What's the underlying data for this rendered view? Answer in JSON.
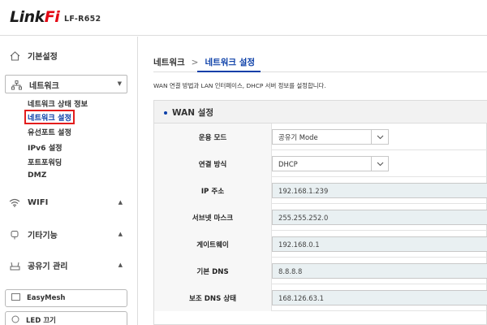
{
  "header": {
    "logo_main": "Link",
    "logo_accent": "Fi",
    "model": "LF-R652"
  },
  "sidebar": {
    "basic": "기본설정",
    "network": "네트워크",
    "network_items": [
      "네트워크 상태 정보",
      "네트워크 설정",
      "유선포트 설정",
      "IPv6 설정",
      "포트포워딩",
      "DMZ"
    ],
    "wifi": "WIFI",
    "extra": "기타기능",
    "admin": "공유기 관리",
    "easymesh": "EasyMesh",
    "led": "LED 끄기"
  },
  "breadcrumb": {
    "parent": "네트워크",
    "separator": ">",
    "current": "네트워크 설정"
  },
  "description": "WAN 연결 방법과 LAN 인터페이스, DHCP 서버 정보를 설정합니다.",
  "wan": {
    "title": "WAN 설정",
    "rows": [
      {
        "label": "운용 모드",
        "value": "공유기 Mode"
      },
      {
        "label": "연결 방식",
        "value": "DHCP"
      },
      {
        "label": "IP 주소",
        "value": "192.168.1.239"
      },
      {
        "label": "서브넷 마스크",
        "value": "255.255.252.0"
      },
      {
        "label": "게이트웨이",
        "value": "192.168.0.1"
      },
      {
        "label": "기본 DNS",
        "value": "8.8.8.8"
      },
      {
        "label": "보조 DNS 상태",
        "value": "168.126.63.1"
      }
    ]
  },
  "colors": {
    "accent": "#0b3fa8",
    "logo_red": "#e30613",
    "highlight_border": "#e31d1d",
    "readonly_field": "#e9f0f2"
  },
  "icons": {
    "basic": "home-gear-icon",
    "network": "network-tree-icon",
    "wifi": "wifi-icon",
    "extra": "power-plug-icon",
    "admin": "router-icon",
    "easymesh": "mesh-icon",
    "led": "bulb-icon"
  }
}
